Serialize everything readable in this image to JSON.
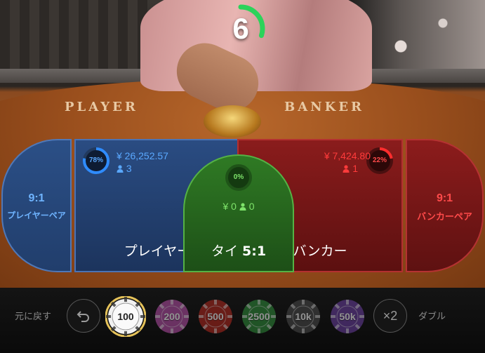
{
  "timer": {
    "value": "6",
    "fraction": 0.3,
    "color": "#2bd35a"
  },
  "table": {
    "player_label": "PLAYER",
    "banker_label": "BANKER"
  },
  "bets": {
    "player_pair": {
      "odds": "9:1",
      "name": "プレイヤーペア",
      "color": "#6fb4ff"
    },
    "player": {
      "label": "プレイヤー",
      "percent": "78%",
      "percent_value": 0.78,
      "amount": "¥ 26,252.57",
      "count": "3",
      "color": "#2f8cff"
    },
    "tie": {
      "label": "タイ",
      "odds": "5:1",
      "percent": "0%",
      "percent_value": 0,
      "amount": "¥ 0",
      "count": "0",
      "color": "#6fdc55"
    },
    "banker": {
      "label": "バンカー",
      "percent": "22%",
      "percent_value": 0.22,
      "amount": "¥ 7,424.80",
      "count": "1",
      "color": "#ff2d2d"
    },
    "banker_pair": {
      "odds": "9:1",
      "name": "バンカーペア",
      "color": "#ff4a4a"
    }
  },
  "controls": {
    "undo_label": "元に戻す",
    "double_label": "ダブル",
    "double_button": "×2",
    "chips": [
      {
        "label": "100",
        "color": "#f1f1f1",
        "selected": true
      },
      {
        "label": "200",
        "color": "#b64fa8"
      },
      {
        "label": "500",
        "color": "#b3281f"
      },
      {
        "label": "2500",
        "color": "#2f8d3a"
      },
      {
        "label": "10k",
        "color": "#4a4a4a"
      },
      {
        "label": "50k",
        "color": "#6a3fa0"
      }
    ]
  }
}
